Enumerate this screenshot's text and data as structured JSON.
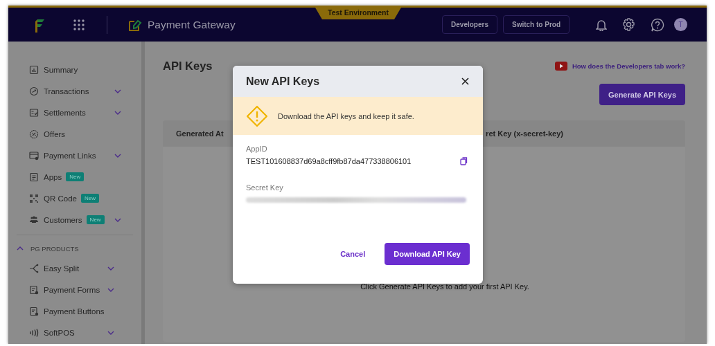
{
  "header": {
    "environment": "Test Environment",
    "app_title": "Payment Gateway",
    "buttons": [
      "Developers",
      "Switch to Prod"
    ],
    "avatar": "T"
  },
  "sidebar": {
    "items": [
      {
        "label": "Summary",
        "has_submenu": false
      },
      {
        "label": "Transactions",
        "has_submenu": true
      },
      {
        "label": "Settlements",
        "has_submenu": true
      },
      {
        "label": "Offers",
        "has_submenu": false
      },
      {
        "label": "Payment Links",
        "has_submenu": true
      },
      {
        "label": "Apps",
        "badge": "New",
        "has_submenu": false
      },
      {
        "label": "QR Code",
        "badge": "New",
        "has_submenu": false
      },
      {
        "label": "Customers",
        "badge": "New",
        "has_submenu": true
      }
    ],
    "section": {
      "label": "PG PRODUCTS",
      "expanded": true,
      "items": [
        {
          "label": "Easy Split",
          "has_submenu": true
        },
        {
          "label": "Payment Forms",
          "has_submenu": true
        },
        {
          "label": "Payment Buttons",
          "has_submenu": false
        },
        {
          "label": "SoftPOS",
          "has_submenu": true
        }
      ]
    }
  },
  "main": {
    "title": "API Keys",
    "help_link": "How does the Developers tab work?",
    "generate_button": "Generate API Keys",
    "table": {
      "columns": [
        "Generated At",
        "ret Key (x-secret-key)"
      ],
      "empty_message": "Click Generate API Keys to add your first API Key."
    }
  },
  "modal": {
    "title": "New API Keys",
    "warning": "Download the API keys and keep it safe.",
    "fields": [
      {
        "label": "AppID",
        "value": "TEST101608837d69a8cff9fb87da477338806101",
        "kind": "plain"
      },
      {
        "label": "Secret Key",
        "kind": "redacted"
      }
    ],
    "buttons": [
      {
        "label": "Cancel",
        "kind": "secondary"
      },
      {
        "label": "Download API Key",
        "kind": "primary"
      }
    ]
  }
}
